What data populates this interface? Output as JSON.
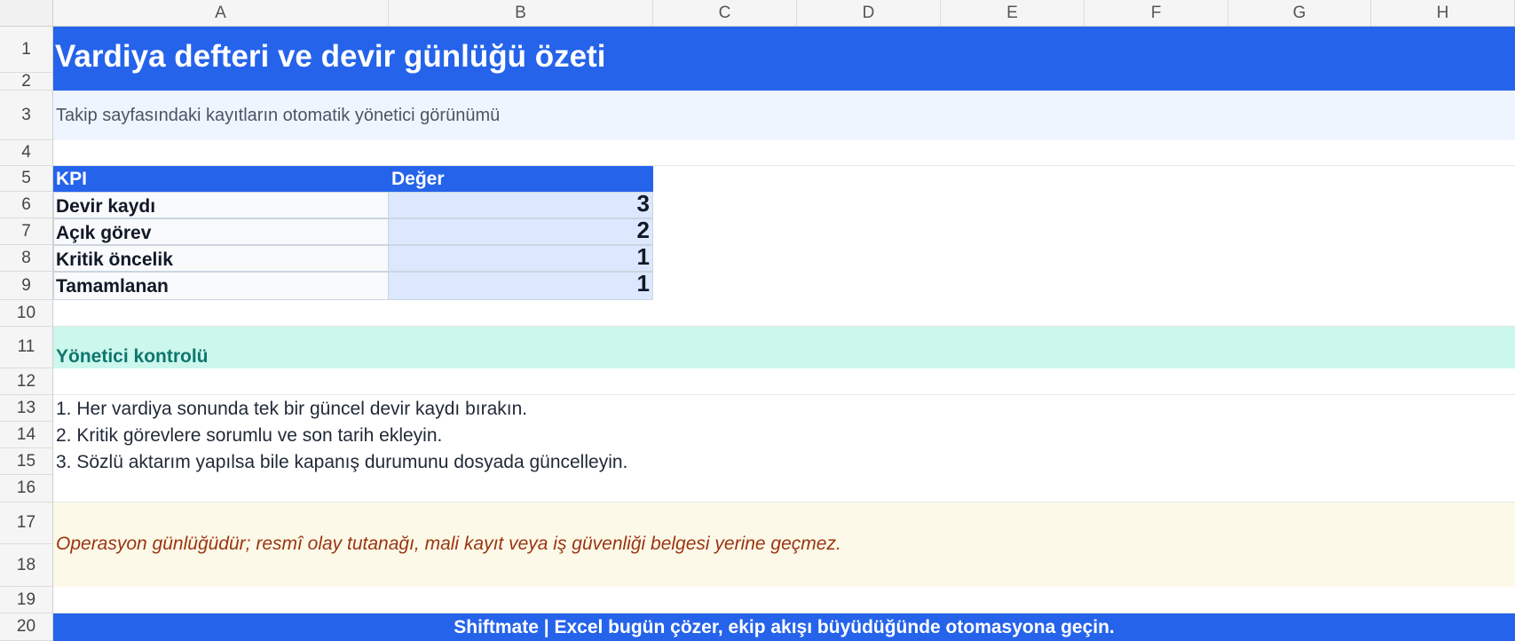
{
  "columns": [
    "A",
    "B",
    "C",
    "D",
    "E",
    "F",
    "G",
    "H"
  ],
  "rows": [
    "1",
    "2",
    "3",
    "4",
    "5",
    "6",
    "7",
    "8",
    "9",
    "10",
    "11",
    "12",
    "13",
    "14",
    "15",
    "16",
    "17",
    "18",
    "19",
    "20"
  ],
  "title": "Vardiya defteri ve devir günlüğü özeti",
  "subtitle": "Takip sayfasındaki kayıtların otomatik yönetici görünümü",
  "kpi": {
    "header_label": "KPI",
    "header_value": "Değer",
    "items": [
      {
        "label": "Devir kaydı",
        "value": "3"
      },
      {
        "label": "Açık görev",
        "value": "2"
      },
      {
        "label": "Kritik öncelik",
        "value": "1"
      },
      {
        "label": "Tamamlanan",
        "value": "1"
      }
    ]
  },
  "control": {
    "heading": "Yönetici kontrolü",
    "steps": [
      "1. Her vardiya sonunda tek bir güncel devir kaydı bırakın.",
      "2. Kritik görevlere sorumlu ve son tarih ekleyin.",
      "3. Sözlü aktarım yapılsa bile kapanış durumunu dosyada güncelleyin."
    ]
  },
  "note": "Operasyon günlüğüdür; resmî olay tutanağı, mali kayıt veya iş güvenliği belgesi yerine geçmez.",
  "footer": "Shiftmate | Excel bugün çözer, ekip akışı büyüdüğünde otomasyona geçin.",
  "colors": {
    "brand_blue": "#2563eb",
    "subtitle_bg": "#eef5ff",
    "value_cell_bg": "#dbe8fd",
    "control_bg": "#ccf7ed",
    "control_text": "#0f766e",
    "note_bg": "#fdf9e8",
    "note_text": "#9a3412"
  }
}
